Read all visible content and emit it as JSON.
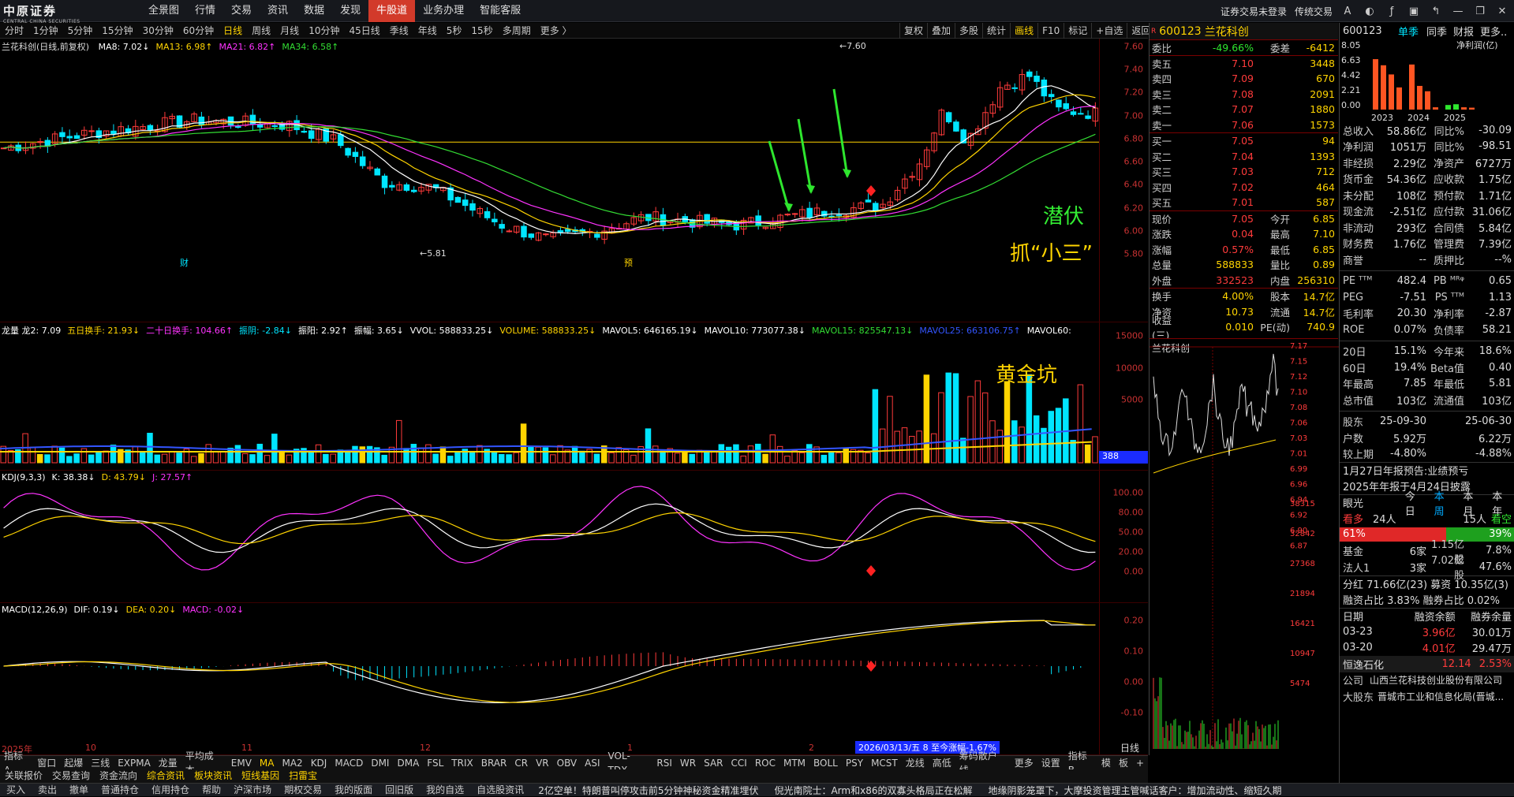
{
  "app": {
    "logo_cn": "中原证券",
    "logo_en": "CENTRAL CHINA SECURITIES",
    "menu": [
      "全景图",
      "行情",
      "交易",
      "资讯",
      "数据",
      "发现",
      "牛股道",
      "业务办理",
      "智能客服"
    ],
    "active_menu": "牛股道",
    "top_right": [
      "证券交易未登录",
      "传统交易"
    ]
  },
  "periods": [
    "分时",
    "1分钟",
    "5分钟",
    "15分钟",
    "30分钟",
    "60分钟",
    "日线",
    "周线",
    "月线",
    "10分钟",
    "45日线",
    "季线",
    "年线",
    "5秒",
    "15秒",
    "多周期",
    "更多 〉"
  ],
  "selected_period": "日线",
  "chart_tools": [
    "复权",
    "叠加",
    "多股",
    "统计",
    "画线",
    "F10",
    "标记",
    "+自选",
    "返回"
  ],
  "selected_tool": "画线",
  "main_chart": {
    "title": "兰花科创(日线,前复权)",
    "ma": [
      {
        "label": "MA8: 7.02↓",
        "color": "#ffffff"
      },
      {
        "label": "MA13: 6.98↑",
        "color": "#ffd400"
      },
      {
        "label": "MA21: 6.82↑",
        "color": "#ff33ff"
      },
      {
        "label": "MA34: 6.58↑",
        "color": "#33dd33"
      }
    ],
    "y_ticks": [
      "7.60",
      "7.40",
      "7.20",
      "7.00",
      "6.80",
      "6.60",
      "6.40",
      "6.20",
      "6.00",
      "5.80"
    ],
    "high_label": "7.60",
    "low_label": "5.81",
    "markers": [
      "财",
      "预"
    ],
    "annot_1": "潜伏",
    "annot_2": "抓“小三”"
  },
  "vol_chart": {
    "legend": [
      {
        "label": "龙量 龙2: 7.09",
        "color": "#ffffff"
      },
      {
        "label": "五日换手: 21.93↓",
        "color": "#ffd400"
      },
      {
        "label": "二十日换手: 104.66↑",
        "color": "#ff33ff"
      },
      {
        "label": "振阴: -2.84↓",
        "color": "#00e5ff"
      },
      {
        "label": "振阳: 2.92↑",
        "color": "#ffffff"
      },
      {
        "label": "振幅: 3.65↓",
        "color": "#ffffff"
      },
      {
        "label": "VVOL: 588833.25↓",
        "color": "#ffffff"
      },
      {
        "label": "VOLUME: 588833.25↓",
        "color": "#ffd400"
      },
      {
        "label": "MAVOL5: 646165.19↓",
        "color": "#ffffff"
      },
      {
        "label": "MAVOL10: 773077.38↓",
        "color": "#ffffff"
      },
      {
        "label": "MAVOL15: 825547.13↓",
        "color": "#33dd33"
      },
      {
        "label": "MAVOL25: 663106.75↑",
        "color": "#3355ff"
      },
      {
        "label": "MAVOL60:",
        "color": "#ffffff"
      }
    ],
    "y_ticks": [
      "15000",
      "10000",
      "5000"
    ],
    "tag": "388",
    "annot": "黄金坑"
  },
  "kdj_chart": {
    "legend": [
      {
        "label": "KDJ(9,3,3)",
        "color": "#ffffff"
      },
      {
        "label": "K: 38.38↓",
        "color": "#ffffff"
      },
      {
        "label": "D: 43.79↓",
        "color": "#ffd400"
      },
      {
        "label": "J: 27.57↑",
        "color": "#ff33ff"
      }
    ],
    "y_ticks": [
      "100.00",
      "80.00",
      "50.00",
      "20.00",
      "0.00"
    ]
  },
  "macd_chart": {
    "legend": [
      {
        "label": "MACD(12,26,9)",
        "color": "#ffffff"
      },
      {
        "label": "DIF: 0.19↓",
        "color": "#ffffff"
      },
      {
        "label": "DEA: 0.20↓",
        "color": "#ffd400"
      },
      {
        "label": "MACD: -0.02↓",
        "color": "#ff33ff"
      }
    ],
    "y_ticks": [
      "0.20",
      "0.10",
      "0.00",
      "-0.10"
    ],
    "x_labels": [
      "2025年",
      "10",
      "11",
      "12",
      "1",
      "2"
    ],
    "cursor_label": "2026/03/13/五 8 至今涨幅-1.67%",
    "corner": "日线"
  },
  "indicators": [
    "指标A",
    "窗口",
    "起爆",
    "三线",
    "EXPMA",
    "龙量",
    "平均成本",
    "EMV",
    "MA",
    "MA2",
    "KDJ",
    "MACD",
    "DMI",
    "DMA",
    "FSL",
    "TRIX",
    "BRAR",
    "CR",
    "VR",
    "OBV",
    "ASI",
    "VOL-TDX",
    "RSI",
    "WR",
    "SAR",
    "CCI",
    "ROC",
    "MTM",
    "BOLL",
    "PSY",
    "MCST",
    "龙线",
    "高低",
    "筹码散户线",
    "更多",
    "设置",
    "指标B",
    "模",
    "板",
    "+"
  ],
  "selected_indicator": "MA",
  "funcs": [
    "关联报价",
    "交易查询",
    "资金流向",
    "综合资讯",
    "板块资讯",
    "短线基因",
    "扫雷宝"
  ],
  "func_sel": [
    "综合资讯",
    "板块资讯",
    "短线基因",
    "扫雷宝"
  ],
  "trade_buttons": [
    "买入",
    "卖出",
    "撤单",
    "普通持仓",
    "信用持仓",
    "帮助",
    "沪深市场",
    "期权交易",
    "我的版面",
    "回旧版",
    "我的自选",
    "自选股资讯"
  ],
  "news": [
    "2亿空单！特朗普叫停攻击前5分钟神秘资金精准埋伏",
    "倪光南院士：Arm和x86的双寡头格局正在松解",
    "地缘阴影笼罩下，大摩投资管理主管喊话客户：增加流动性、缩短久期"
  ],
  "order": {
    "code": "600123",
    "name": "兰花科创",
    "weibi": "-49.66%",
    "weicha": "-6412",
    "asks": [
      {
        "l": "卖五",
        "p": "7.10",
        "q": "3448"
      },
      {
        "l": "卖四",
        "p": "7.09",
        "q": "670"
      },
      {
        "l": "卖三",
        "p": "7.08",
        "q": "2091"
      },
      {
        "l": "卖二",
        "p": "7.07",
        "q": "1880"
      },
      {
        "l": "卖一",
        "p": "7.06",
        "q": "1573"
      }
    ],
    "bids": [
      {
        "l": "买一",
        "p": "7.05",
        "q": "94"
      },
      {
        "l": "买二",
        "p": "7.04",
        "q": "1393"
      },
      {
        "l": "买三",
        "p": "7.03",
        "q": "712"
      },
      {
        "l": "买四",
        "p": "7.02",
        "q": "464"
      },
      {
        "l": "买五",
        "p": "7.01",
        "q": "587"
      }
    ],
    "stats": [
      {
        "k": "现价",
        "v": "7.05",
        "k2": "今开",
        "v2": "6.85",
        "c1": "red",
        "c2": "green"
      },
      {
        "k": "涨跌",
        "v": "0.04",
        "k2": "最高",
        "v2": "7.10",
        "c1": "red",
        "c2": "red"
      },
      {
        "k": "涨幅",
        "v": "0.57%",
        "k2": "最低",
        "v2": "6.85",
        "c1": "red",
        "c2": "green"
      },
      {
        "k": "总量",
        "v": "588833",
        "k2": "量比",
        "v2": "0.89",
        "c1": "yellow",
        "c2": "yellow"
      },
      {
        "k": "外盘",
        "v": "332523",
        "k2": "内盘",
        "v2": "256310",
        "c1": "red",
        "c2": "green"
      }
    ],
    "stats2": [
      {
        "k": "换手",
        "v": "4.00%",
        "k2": "股本",
        "v2": "14.7亿"
      },
      {
        "k": "净资",
        "v": "10.73",
        "k2": "流通",
        "v2": "14.7亿"
      },
      {
        "k": "收益(三)",
        "v": "0.010",
        "k2": "PE(动)",
        "v2": "740.9"
      }
    ],
    "mini_title": "兰花科创",
    "mini_y": [
      "7.17",
      "7.15",
      "7.12",
      "7.10",
      "7.08",
      "7.06",
      "7.03",
      "7.01",
      "6.99",
      "6.96",
      "6.94",
      "6.92",
      "6.90",
      "6.87"
    ],
    "mini_vol": [
      "38315",
      "32842",
      "27368",
      "21894",
      "16421",
      "10947",
      "5474"
    ]
  },
  "fin": {
    "code": "600123",
    "tabs": [
      "单季",
      "同季",
      "财报",
      "更多.."
    ],
    "profit_label": "净利润(亿)",
    "profit_y": [
      "8.05",
      "6.63",
      "4.42",
      "2.21",
      "0.00"
    ],
    "years": [
      "2023",
      "2024",
      "2025"
    ],
    "profit_values": [
      6.6,
      5.8,
      4.6,
      2.9,
      5.9,
      3.1,
      2.4,
      0.3,
      0.6,
      0.7,
      0.3,
      0.25
    ],
    "rows": [
      {
        "k": "总收入",
        "v1": "58.86亿",
        "k2": "同比%",
        "v2": "-30.09"
      },
      {
        "k": "净利润",
        "v1": "1051万",
        "k2": "同比%",
        "v2": "-98.51"
      },
      {
        "k": "非经损",
        "v1": "2.29亿",
        "k2": "净资产",
        "v2": "6727万"
      },
      {
        "k": "货币金",
        "v1": "54.36亿",
        "k2": "应收款",
        "v2": "1.75亿"
      },
      {
        "k": "未分配",
        "v1": "108亿",
        "k2": "预付款",
        "v2": "1.71亿"
      },
      {
        "k": "现金流",
        "v1": "-2.51亿",
        "k2": "应付款",
        "v2": "31.06亿"
      },
      {
        "k": "非流动",
        "v1": "293亿",
        "k2": "合同债",
        "v2": "5.84亿"
      },
      {
        "k": "财务费",
        "v1": "1.76亿",
        "k2": "管理费",
        "v2": "7.39亿"
      },
      {
        "k": "商誉",
        "v1": "--",
        "k2": "质押比",
        "v2": "--%"
      }
    ],
    "rows2": [
      {
        "k": "PE ᵀᵀᴹ",
        "v1": "482.4",
        "k2": "PB ᴹᴿᵠ",
        "v2": "0.65"
      },
      {
        "k": "PEG",
        "v1": "-7.51",
        "k2": "PS ᵀᵀᴹ",
        "v2": "1.13"
      },
      {
        "k": "毛利率",
        "v1": "20.30",
        "k2": "净利率",
        "v2": "-2.87"
      },
      {
        "k": "ROE",
        "v1": "0.07%",
        "k2": "负债率",
        "v2": "58.21"
      }
    ],
    "rows3": [
      {
        "k": "20日",
        "v1": "15.1%",
        "k2": "今年来",
        "v2": "18.6%"
      },
      {
        "k": "60日",
        "v1": "19.4%",
        "k2": "Beta值",
        "v2": "0.40"
      },
      {
        "k": "年最高",
        "v1": "7.85",
        "k2": "年最低",
        "v2": "5.81"
      },
      {
        "k": "总市值",
        "v1": "103亿",
        "k2": "流通值",
        "v2": "103亿"
      }
    ],
    "rows4": [
      {
        "k": "股东",
        "v1": "25-09-30",
        "k2": "",
        "v2": "25-06-30"
      },
      {
        "k": "户数",
        "v1": "5.92万",
        "k2": "",
        "v2": "6.22万"
      },
      {
        "k": "较上期",
        "v1": "-4.80%",
        "k2": "",
        "v2": "-4.88%"
      }
    ],
    "note1": "1月27日年报预告:业绩预亏",
    "note2": "2025年年报于4月24日披露",
    "eye_label": "眼光",
    "eye_tabs": [
      "今日",
      "本周",
      "本月",
      "本年"
    ],
    "bull": "看多",
    "bull_n": "24人",
    "bear_n": "15人",
    "bear": "看空",
    "bull_pct": "61%",
    "bear_pct": "39%",
    "fund_rows": [
      {
        "k": "基金",
        "v1": "6家",
        "k2": "1.15亿股",
        "v2": "7.8%"
      },
      {
        "k": "法人1",
        "v1": "3家",
        "k2": "7.02亿股",
        "v2": "47.6%"
      }
    ],
    "margin1": "分红 71.66亿(23)  募资 10.35亿(3)",
    "margin2": "融资占比  3.83%  融券占比  0.02%",
    "margin_head": [
      "日期",
      "融资余额",
      "融券余量"
    ],
    "margin_rows": [
      {
        "d": "03-23",
        "a": "3.96亿",
        "b": "30.01万"
      },
      {
        "d": "03-20",
        "a": "4.01亿",
        "b": "29.47万"
      }
    ],
    "peer_name": "恒逸石化",
    "peer_price": "12.14",
    "peer_pct": "2.53%",
    "company_k": "公司",
    "company_v": "山西兰花科技创业股份有限公司",
    "major_k": "大股东",
    "major_v": "晋城市工业和信息化局(晋城..."
  }
}
